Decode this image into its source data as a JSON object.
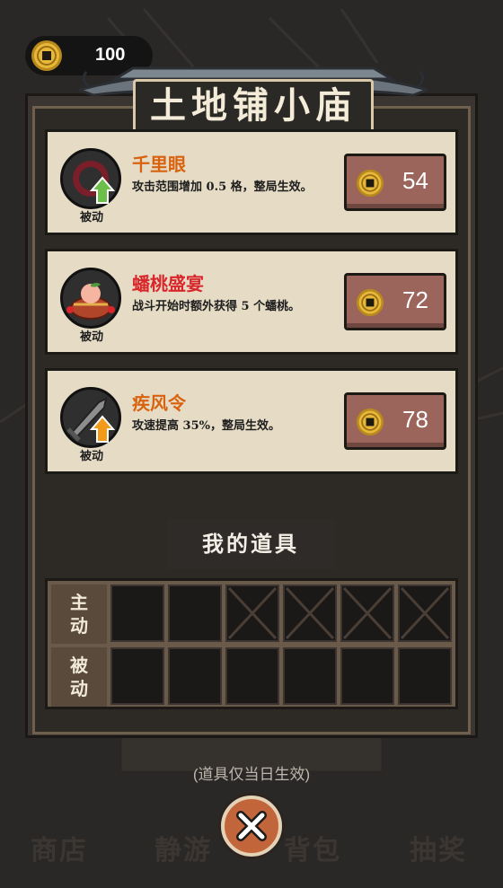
{
  "coins": {
    "count": "100"
  },
  "shop": {
    "title": "土地铺小庙",
    "items": [
      {
        "name": "千里眼",
        "name_color": "#d9620f",
        "description": "攻击范围增加 0.5 格，整局生效。",
        "tag": "被动",
        "price": "54",
        "icon": "eye-upgrade-icon"
      },
      {
        "name": "蟠桃盛宴",
        "name_color": "#d8262a",
        "description": "战斗开始时额外获得 5 个蟠桃。",
        "tag": "被动",
        "price": "72",
        "icon": "peach-basket-icon"
      },
      {
        "name": "疾风令",
        "name_color": "#d9620f",
        "description": "攻速提高 35%，整局生效。",
        "tag": "被动",
        "price": "78",
        "icon": "sword-upgrade-icon"
      }
    ]
  },
  "inventory": {
    "title": "我的道具",
    "rows": [
      {
        "label": "主动",
        "slots": [
          "empty",
          "empty",
          "locked",
          "locked",
          "locked",
          "locked"
        ]
      },
      {
        "label": "被动",
        "slots": [
          "empty",
          "empty",
          "empty",
          "empty",
          "empty",
          "empty"
        ]
      }
    ]
  },
  "notice": "(道具仅当日生效)",
  "nav": [
    "商店",
    "静游",
    "背包",
    "抽奖"
  ]
}
